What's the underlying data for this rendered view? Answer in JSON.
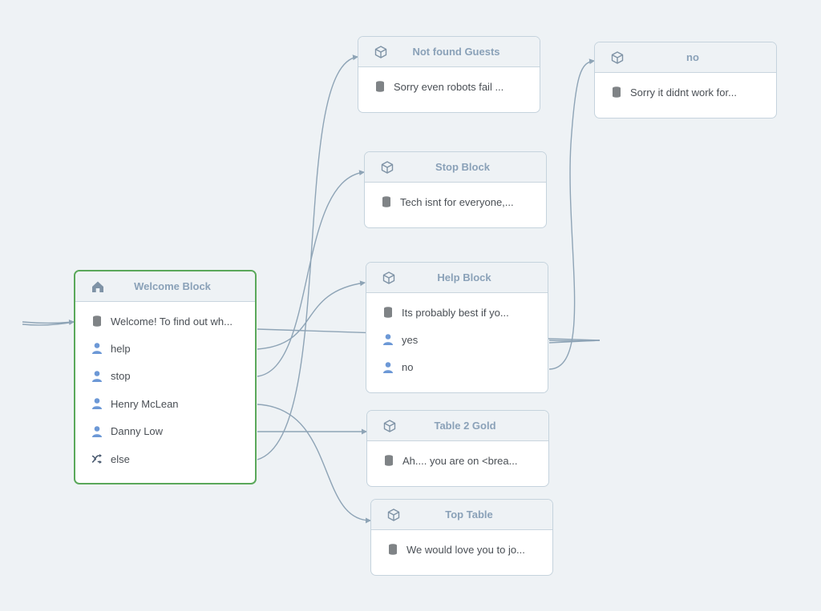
{
  "colors": {
    "background": "#eef2f5",
    "connector": "#8ea4b6",
    "start_border": "#5aa85a",
    "title": "#8aa1b8",
    "user_icon": "#6c98d6",
    "message_icon": "#7f8386"
  },
  "blocks": {
    "welcome": {
      "title": "Welcome Block",
      "icon": "home-icon",
      "rows": [
        {
          "icon": "message-icon",
          "text": "Welcome! To find out wh..."
        },
        {
          "icon": "user-icon",
          "text": "help"
        },
        {
          "icon": "user-icon",
          "text": "stop"
        },
        {
          "icon": "user-icon",
          "text": "Henry McLean"
        },
        {
          "icon": "user-icon",
          "text": "Danny Low"
        },
        {
          "icon": "shuffle-icon",
          "text": "else"
        }
      ]
    },
    "not_found_guests": {
      "title": "Not found Guests",
      "icon": "cube-icon",
      "rows": [
        {
          "icon": "message-icon",
          "text": "Sorry even robots fail ..."
        }
      ]
    },
    "no": {
      "title": "no",
      "icon": "cube-icon",
      "rows": [
        {
          "icon": "message-icon",
          "text": "Sorry it didnt work for..."
        }
      ]
    },
    "stop_block": {
      "title": "Stop Block",
      "icon": "cube-icon",
      "rows": [
        {
          "icon": "message-icon",
          "text": "Tech isnt for everyone,..."
        }
      ]
    },
    "help_block": {
      "title": "Help Block",
      "icon": "cube-icon",
      "rows": [
        {
          "icon": "message-icon",
          "text": "Its probably best if yo..."
        },
        {
          "icon": "user-icon",
          "text": "yes"
        },
        {
          "icon": "user-icon",
          "text": "no"
        }
      ]
    },
    "table_2_gold": {
      "title": "Table 2 Gold",
      "icon": "cube-icon",
      "rows": [
        {
          "icon": "message-icon",
          "text": "Ah.... you are on <brea..."
        }
      ]
    },
    "top_table": {
      "title": "Top Table",
      "icon": "cube-icon",
      "rows": [
        {
          "icon": "message-icon",
          "text": "We would love you to jo..."
        }
      ]
    }
  }
}
